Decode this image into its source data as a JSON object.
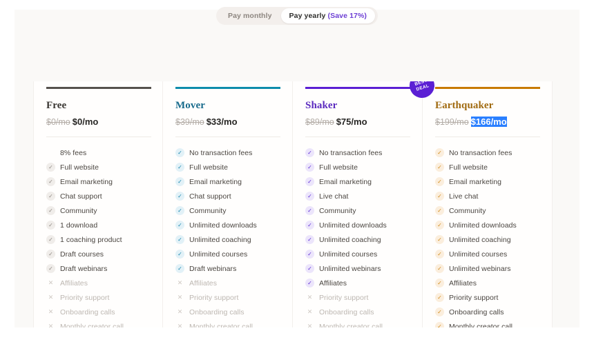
{
  "billing_toggle": {
    "name": "billing-period-toggle",
    "options": [
      {
        "label": "Pay monthly",
        "active": false
      },
      {
        "label": "Pay yearly",
        "suffix": "(Save 17%)",
        "active": true
      }
    ]
  },
  "colors": {
    "page_background": "#ffffff",
    "content_background": "#faf9f7",
    "card_background": "#fffefd",
    "selection_highlight": "#2a7fff",
    "save_note": "#6d3fd4"
  },
  "plans": [
    {
      "name": "Free",
      "accent": "#55514d",
      "title_color": "#3a3733",
      "icon_bg": "#f0edea",
      "icon_color": "#8d8780",
      "price_old": "$0/mo",
      "price_new": "$0/mo",
      "price_selected": false,
      "badge": null,
      "features": [
        {
          "label": "8% fees",
          "state": "plain"
        },
        {
          "label": "Full website",
          "state": "included"
        },
        {
          "label": "Email marketing",
          "state": "included"
        },
        {
          "label": "Chat support",
          "state": "included"
        },
        {
          "label": "Community",
          "state": "included"
        },
        {
          "label": "1 download",
          "state": "included"
        },
        {
          "label": "1 coaching product",
          "state": "included"
        },
        {
          "label": "Draft courses",
          "state": "included"
        },
        {
          "label": "Draft webinars",
          "state": "included"
        },
        {
          "label": "Affiliates",
          "state": "excluded"
        },
        {
          "label": "Priority support",
          "state": "excluded"
        },
        {
          "label": "Onboarding calls",
          "state": "excluded"
        },
        {
          "label": "Monthly creator call",
          "state": "excluded"
        }
      ]
    },
    {
      "name": "Mover",
      "accent": "#0d8cab",
      "title_color": "#186b8c",
      "icon_bg": "#e2f1f7",
      "icon_color": "#1585ad",
      "price_old": "$39/mo",
      "price_new": "$33/mo",
      "price_selected": false,
      "badge": null,
      "features": [
        {
          "label": "No transaction fees",
          "state": "included"
        },
        {
          "label": "Full website",
          "state": "included"
        },
        {
          "label": "Email marketing",
          "state": "included"
        },
        {
          "label": "Chat support",
          "state": "included"
        },
        {
          "label": "Community",
          "state": "included"
        },
        {
          "label": "Unlimited downloads",
          "state": "included"
        },
        {
          "label": "Unlimited coaching",
          "state": "included"
        },
        {
          "label": "Unlimited courses",
          "state": "included"
        },
        {
          "label": "Draft webinars",
          "state": "included"
        },
        {
          "label": "Affiliates",
          "state": "excluded"
        },
        {
          "label": "Priority support",
          "state": "excluded"
        },
        {
          "label": "Onboarding calls",
          "state": "excluded"
        },
        {
          "label": "Monthly creator call",
          "state": "excluded"
        }
      ]
    },
    {
      "name": "Shaker",
      "accent": "#5b1fd4",
      "title_color": "#5b2bbf",
      "icon_bg": "#ece5fb",
      "icon_color": "#5b2bd4",
      "price_old": "$89/mo",
      "price_new": "$75/mo",
      "price_selected": false,
      "badge": {
        "line1": "BEST",
        "line2": "DEAL",
        "color": "#5b1fd4"
      },
      "features": [
        {
          "label": "No transaction fees",
          "state": "included"
        },
        {
          "label": "Full website",
          "state": "included"
        },
        {
          "label": "Email marketing",
          "state": "included"
        },
        {
          "label": "Live chat",
          "state": "included"
        },
        {
          "label": "Community",
          "state": "included"
        },
        {
          "label": "Unlimited downloads",
          "state": "included"
        },
        {
          "label": "Unlimited coaching",
          "state": "included"
        },
        {
          "label": "Unlimited courses",
          "state": "included"
        },
        {
          "label": "Unlimited webinars",
          "state": "included"
        },
        {
          "label": "Affiliates",
          "state": "included"
        },
        {
          "label": "Priority support",
          "state": "excluded"
        },
        {
          "label": "Onboarding calls",
          "state": "excluded"
        },
        {
          "label": "Monthly creator call",
          "state": "excluded"
        }
      ]
    },
    {
      "name": "Earthquaker",
      "accent": "#c87a00",
      "title_color": "#a06a10",
      "icon_bg": "#fbeedd",
      "icon_color": "#d08a1a",
      "price_old": "$199/mo",
      "price_new": "$166/mo",
      "price_selected": true,
      "badge": null,
      "features": [
        {
          "label": "No transaction fees",
          "state": "included"
        },
        {
          "label": "Full website",
          "state": "included"
        },
        {
          "label": "Email marketing",
          "state": "included"
        },
        {
          "label": "Live chat",
          "state": "included"
        },
        {
          "label": "Community",
          "state": "included"
        },
        {
          "label": "Unlimited downloads",
          "state": "included"
        },
        {
          "label": "Unlimited coaching",
          "state": "included"
        },
        {
          "label": "Unlimited courses",
          "state": "included"
        },
        {
          "label": "Unlimited webinars",
          "state": "included"
        },
        {
          "label": "Affiliates",
          "state": "included"
        },
        {
          "label": "Priority support",
          "state": "included"
        },
        {
          "label": "Onboarding calls",
          "state": "included"
        },
        {
          "label": "Monthly creator call",
          "state": "included"
        }
      ]
    }
  ],
  "icons": {
    "check": "✓",
    "cross": "✕"
  }
}
